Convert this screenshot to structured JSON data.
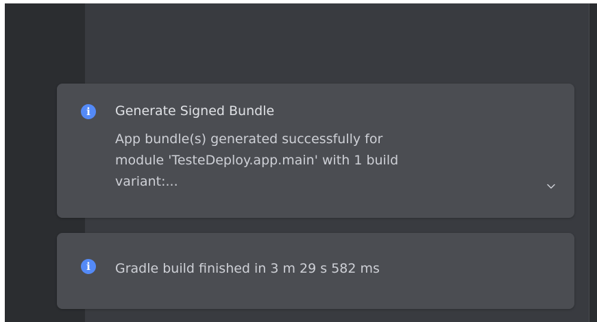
{
  "notifications": [
    {
      "title": "Generate Signed Bundle",
      "body_lines": [
        "App bundle(s) generated successfully for",
        "module 'TesteDeploy.app.main' with 1 build",
        "variant:..."
      ],
      "icon": "info-icon",
      "expandable": true,
      "expand_icon": "chevron-down-icon"
    },
    {
      "title": "",
      "body_lines": [
        "Gradle build finished in 3 m 29 s 582 ms"
      ],
      "icon": "info-icon",
      "expandable": false
    }
  ],
  "colors": {
    "info_accent": "#548af7",
    "card_background": "#4b4d52",
    "editor_background": "#393b40",
    "sidebar_background": "#2b2d30",
    "title_text": "#dfe1e5",
    "body_text": "#ced0d6"
  }
}
